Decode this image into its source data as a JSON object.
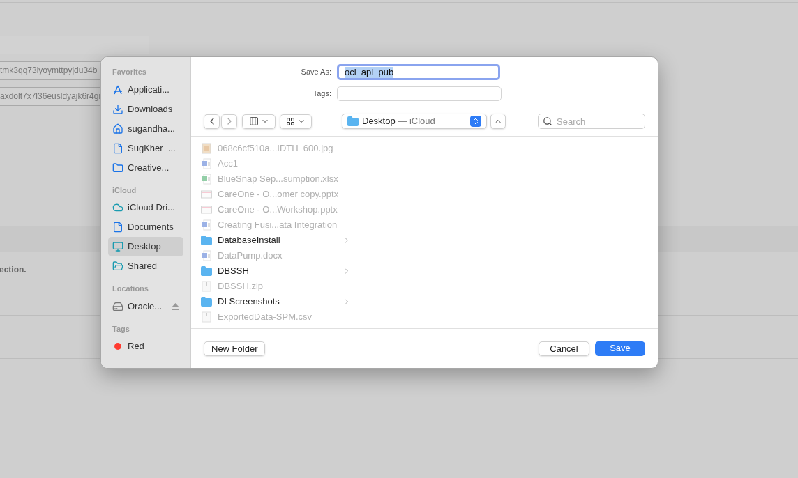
{
  "background": {
    "fields": [
      "tmk3qq73iyoymttpyjdu34b",
      "axdolt7x7l36eusldyajk6r4gr"
    ],
    "note": "ection."
  },
  "sidebar": {
    "sections": [
      {
        "title": "Favorites",
        "items": [
          {
            "label": "Applicati...",
            "kind": "apps",
            "selected": false
          },
          {
            "label": "Downloads",
            "kind": "download",
            "selected": false
          },
          {
            "label": "sugandha...",
            "kind": "home",
            "selected": false
          },
          {
            "label": "SugKher_...",
            "kind": "document",
            "selected": false
          },
          {
            "label": "Creative...",
            "kind": "folder",
            "selected": false
          }
        ]
      },
      {
        "title": "iCloud",
        "items": [
          {
            "label": "iCloud Dri...",
            "kind": "cloud",
            "selected": false
          },
          {
            "label": "Documents",
            "kind": "document",
            "selected": false
          },
          {
            "label": "Desktop",
            "kind": "desktop",
            "selected": true
          },
          {
            "label": "Shared",
            "kind": "shared",
            "selected": false
          }
        ]
      },
      {
        "title": "Locations",
        "items": [
          {
            "label": "Oracle...",
            "kind": "drive",
            "selected": false
          }
        ]
      },
      {
        "title": "Tags",
        "items": [
          {
            "label": "Red",
            "kind": "tag",
            "color": "#ff3b30",
            "selected": false
          }
        ]
      }
    ]
  },
  "save_as": {
    "label": "Save As:",
    "value": "oci_api_pub"
  },
  "tags": {
    "label": "Tags:"
  },
  "location": {
    "name": "Desktop",
    "suffix": "— iCloud"
  },
  "search": {
    "placeholder": "Search"
  },
  "files": [
    {
      "name": "068c6cf510a...IDTH_600.jpg",
      "kind": "image",
      "disabled": true
    },
    {
      "name": "Acc1",
      "kind": "word",
      "disabled": true
    },
    {
      "name": "BlueSnap Sep...sumption.xlsx",
      "kind": "excel",
      "disabled": true
    },
    {
      "name": "CareOne - O...omer copy.pptx",
      "kind": "slides",
      "disabled": true
    },
    {
      "name": "CareOne - O...Workshop.pptx",
      "kind": "slides",
      "disabled": true
    },
    {
      "name": "Creating Fusi...ata Integration",
      "kind": "word",
      "disabled": true
    },
    {
      "name": "DatabaseInstall",
      "kind": "folder",
      "disabled": false
    },
    {
      "name": "DataPump.docx",
      "kind": "word",
      "disabled": true
    },
    {
      "name": "DBSSH",
      "kind": "folder",
      "disabled": false
    },
    {
      "name": "DBSSH.zip",
      "kind": "zip",
      "disabled": true
    },
    {
      "name": "DI Screenshots",
      "kind": "folder",
      "disabled": false
    },
    {
      "name": "ExportedData-SPM.csv",
      "kind": "csv",
      "disabled": true
    }
  ],
  "buttons": {
    "new_folder": "New Folder",
    "cancel": "Cancel",
    "save": "Save"
  }
}
